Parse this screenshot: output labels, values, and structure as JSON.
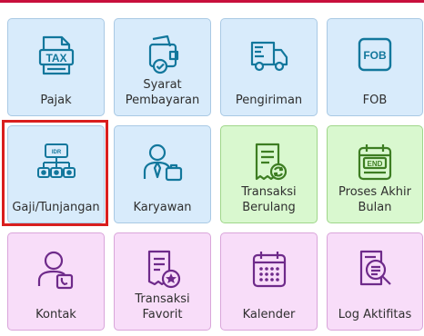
{
  "tiles": [
    {
      "label": "Pajak",
      "icon": "tax-icon",
      "color": "blue"
    },
    {
      "label": "Syarat\nPembayaran",
      "icon": "payment-terms-icon",
      "color": "blue"
    },
    {
      "label": "Pengiriman",
      "icon": "truck-icon",
      "color": "blue"
    },
    {
      "label": "FOB",
      "icon": "fob-icon",
      "color": "blue"
    },
    {
      "label": "Gaji/Tunjangan",
      "icon": "salary-icon",
      "color": "blue",
      "selected": true
    },
    {
      "label": "Karyawan",
      "icon": "employee-icon",
      "color": "blue"
    },
    {
      "label": "Transaksi\nBerulang",
      "icon": "recurring-transaction-icon",
      "color": "green"
    },
    {
      "label": "Proses Akhir\nBulan",
      "icon": "month-end-icon",
      "color": "green"
    },
    {
      "label": "Kontak",
      "icon": "contact-icon",
      "color": "purple"
    },
    {
      "label": "Transaksi\nFavorit",
      "icon": "favorite-transaction-icon",
      "color": "purple"
    },
    {
      "label": "Kalender",
      "icon": "calendar-icon",
      "color": "purple"
    },
    {
      "label": "Log Aktifitas",
      "icon": "activity-log-icon",
      "color": "purple"
    }
  ],
  "icon_text": {
    "tax": "TAX",
    "fob": "FOB",
    "end": "END",
    "money": "IDR"
  },
  "colors": {
    "blue_icon": "#12779c",
    "green_icon": "#3d7d22",
    "purple_icon": "#6e2a8a",
    "selection": "#d91e1e",
    "accent_top": "#c8103c"
  }
}
